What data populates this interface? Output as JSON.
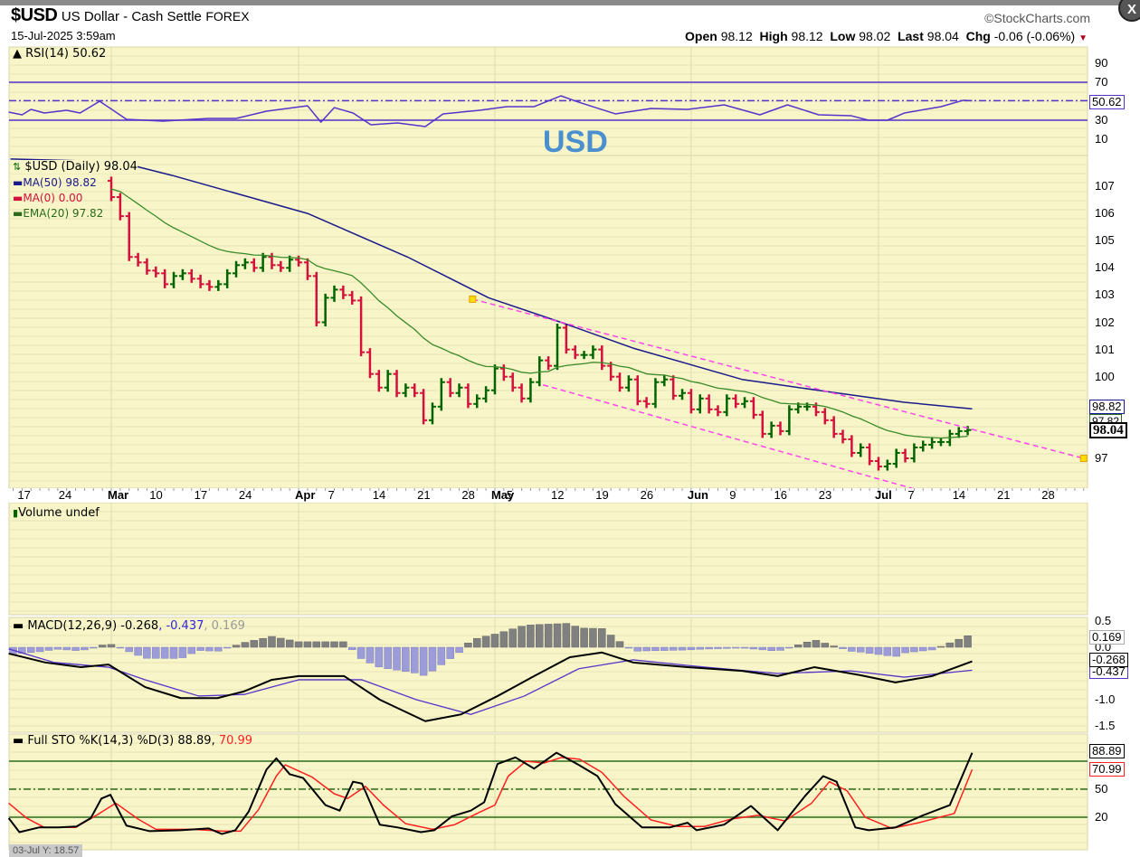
{
  "header": {
    "symbol": "$USD",
    "name": "US Dollar - Cash Settle",
    "exchange": "FOREX",
    "datetime": "15-Jul-2025 3:59am",
    "brand": "©StockCharts.com",
    "open_label": "Open",
    "open": "98.12",
    "high_label": "High",
    "high": "98.12",
    "low_label": "Low",
    "low": "98.02",
    "last_label": "Last",
    "last": "98.04",
    "chg_label": "Chg",
    "chg": "-0.06 (-0.06%)",
    "close_button": "X"
  },
  "watermark": "USD",
  "crosshair_readout": "03-Jul Y: 18.57",
  "colors": {
    "panel_bg": "#f8f6c8",
    "up": "#006400",
    "down": "#d4103c",
    "ma50": "#1a1a8c",
    "ema20": "#3a8a2a",
    "trend": "#ff44ee",
    "rsi": "#5533cc",
    "signal": "#5533cc",
    "stoD": "#ff2020"
  },
  "rsi": {
    "legend": "RSI(14) 50.62",
    "ticks": [
      "90",
      "70",
      "30",
      "10"
    ],
    "tag": "50.62",
    "series": [
      [
        -11.5,
        38.6
      ],
      [
        -10,
        35.7
      ],
      [
        -9,
        41.4
      ],
      [
        -7.5,
        37.6
      ],
      [
        -5,
        40.5
      ],
      [
        -3.5,
        37.6
      ],
      [
        -1.3,
        50
      ],
      [
        1.7,
        31
      ],
      [
        5.8,
        29
      ],
      [
        10.9,
        31.9
      ],
      [
        14,
        31.9
      ],
      [
        17.4,
        39.5
      ],
      [
        22,
        45.2
      ],
      [
        23.5,
        28
      ],
      [
        25,
        43.3
      ],
      [
        27.1,
        37.6
      ],
      [
        29.1,
        25.2
      ],
      [
        32.1,
        27.1
      ],
      [
        35.2,
        23.3
      ],
      [
        37.2,
        36.7
      ],
      [
        41.3,
        40.5
      ],
      [
        44.3,
        44.3
      ],
      [
        47.4,
        44.3
      ],
      [
        50.4,
        55.7
      ],
      [
        52.4,
        49
      ],
      [
        56.5,
        36.7
      ],
      [
        60.5,
        42.4
      ],
      [
        64.6,
        41.4
      ],
      [
        68.7,
        46.2
      ],
      [
        72.7,
        35.7
      ],
      [
        75.8,
        46.2
      ],
      [
        79.3,
        35.7
      ],
      [
        82.9,
        34.8
      ],
      [
        84.9,
        30
      ],
      [
        87,
        30
      ],
      [
        88.9,
        37.6
      ],
      [
        93,
        44.3
      ],
      [
        95.5,
        51
      ],
      [
        96.5,
        50.62
      ]
    ]
  },
  "price": {
    "legend_title": "$USD (Daily) 98.04",
    "ma50_legend": "MA(50) 98.82",
    "ma0_legend": "MA(0) 0.00",
    "ema20_legend": "EMA(20) 97.82",
    "ticks": [
      "107",
      "106",
      "105",
      "104",
      "103",
      "102",
      "101",
      "100",
      "97"
    ],
    "tag_ma50": "98.82",
    "tag_last": "98.04",
    "tag_ema": "97.82",
    "first_open": 107.2,
    "closes": [
      106.6,
      105.9,
      104.4,
      104.2,
      103.9,
      103.8,
      103.4,
      103.7,
      103.8,
      103.6,
      103.4,
      103.3,
      103.4,
      103.8,
      104.1,
      104.2,
      104.0,
      104.4,
      104.1,
      104.0,
      104.3,
      104.2,
      103.7,
      102.0,
      102.9,
      103.2,
      103.0,
      102.8,
      100.9,
      100.1,
      99.6,
      100.1,
      99.4,
      99.6,
      99.4,
      98.4,
      98.9,
      99.8,
      99.4,
      99.6,
      99.0,
      99.2,
      99.5,
      100.3,
      100.0,
      99.6,
      99.2,
      99.8,
      100.6,
      100.4,
      101.8,
      101.0,
      100.8,
      100.8,
      101.0,
      100.4,
      100.0,
      99.6,
      99.9,
      99.1,
      99.0,
      99.8,
      99.9,
      99.3,
      99.4,
      98.8,
      99.2,
      98.8,
      98.7,
      99.2,
      99.0,
      99.1,
      98.6,
      97.9,
      98.2,
      98.0,
      98.8,
      98.9,
      98.9,
      98.7,
      98.4,
      97.9,
      97.7,
      97.2,
      97.4,
      96.9,
      96.7,
      96.8,
      97.2,
      97.0,
      97.4,
      97.5,
      97.6,
      97.6,
      97.9,
      98.0,
      98.04
    ],
    "ma50": [
      [
        -11.3,
        108.0
      ],
      [
        0.7,
        107.9
      ],
      [
        6.8,
        107.4
      ],
      [
        22,
        106.0
      ],
      [
        33.2,
        104.4
      ],
      [
        42.3,
        102.9
      ],
      [
        50.4,
        102.0
      ],
      [
        58.5,
        101.05
      ],
      [
        70.7,
        99.9
      ],
      [
        80.3,
        99.45
      ],
      [
        88.9,
        99.06
      ],
      [
        96.5,
        98.82
      ]
    ],
    "trendlines": [
      {
        "from": [
          40.5,
          102.85
        ],
        "to": [
          109,
          97.0
        ],
        "anchors": true
      },
      {
        "from": [
          48.4,
          99.7
        ],
        "to": [
          93,
          95.6
        ],
        "anchors": false
      }
    ]
  },
  "x_axis": [
    {
      "d": -9.8,
      "label": "17",
      "month": false
    },
    {
      "d": -5.2,
      "label": "24",
      "month": false
    },
    {
      "d": 0,
      "label": "Mar",
      "month": true
    },
    {
      "d": 5,
      "label": "10",
      "month": false
    },
    {
      "d": 10,
      "label": "17",
      "month": false
    },
    {
      "d": 15,
      "label": "24",
      "month": false
    },
    {
      "d": 21,
      "label": "Apr",
      "month": true
    },
    {
      "d": 25,
      "label": "7",
      "month": false
    },
    {
      "d": 30,
      "label": "14",
      "month": false
    },
    {
      "d": 35,
      "label": "21",
      "month": false
    },
    {
      "d": 40,
      "label": "28",
      "month": false
    },
    {
      "d": 43,
      "label": "May",
      "month": true
    },
    {
      "d": 45,
      "label": "5",
      "month": false
    },
    {
      "d": 50,
      "label": "12",
      "month": false
    },
    {
      "d": 55,
      "label": "19",
      "month": false
    },
    {
      "d": 60,
      "label": "26",
      "month": false
    },
    {
      "d": 65,
      "label": "Jun",
      "month": true
    },
    {
      "d": 70,
      "label": "9",
      "month": false
    },
    {
      "d": 75,
      "label": "16",
      "month": false
    },
    {
      "d": 80,
      "label": "23",
      "month": false
    },
    {
      "d": 86,
      "label": "Jul",
      "month": true
    },
    {
      "d": 90,
      "label": "7",
      "month": false
    },
    {
      "d": 95,
      "label": "14",
      "month": false
    },
    {
      "d": 100,
      "label": "21",
      "month": false
    },
    {
      "d": 105,
      "label": "28",
      "month": false
    }
  ],
  "volume": {
    "legend": "Volume undef"
  },
  "macd": {
    "legend_main": "MACD(12,26,9) -0.268",
    "legend_signal": ", -0.437",
    "legend_hist": ", 0.169",
    "ticks": [
      "0.5",
      "0.0",
      "-1.0",
      "-1.5"
    ],
    "tag_hist": "0.169",
    "tag_macd": "-0.268",
    "tag_signal": "-0.437",
    "macd_line": [
      [
        -11.5,
        -0.12
      ],
      [
        -7.4,
        -0.29
      ],
      [
        -3.4,
        -0.38
      ],
      [
        -0.3,
        -0.33
      ],
      [
        3.8,
        -0.76
      ],
      [
        7.8,
        -0.97
      ],
      [
        11.9,
        -0.97
      ],
      [
        14.9,
        -0.84
      ],
      [
        18,
        -0.62
      ],
      [
        21,
        -0.55
      ],
      [
        26.1,
        -0.55
      ],
      [
        30.1,
        -1.0
      ],
      [
        35.2,
        -1.41
      ],
      [
        39.2,
        -1.28
      ],
      [
        43.3,
        -0.93
      ],
      [
        47.4,
        -0.55
      ],
      [
        51.4,
        -0.19
      ],
      [
        55,
        -0.1
      ],
      [
        58.5,
        -0.29
      ],
      [
        64.6,
        -0.38
      ],
      [
        70.7,
        -0.45
      ],
      [
        74.7,
        -0.55
      ],
      [
        78.8,
        -0.38
      ],
      [
        83.9,
        -0.53
      ],
      [
        87.9,
        -0.67
      ],
      [
        92,
        -0.55
      ],
      [
        96.5,
        -0.268
      ]
    ],
    "signal_line": [
      [
        -11.5,
        -0.03
      ],
      [
        -6.4,
        -0.29
      ],
      [
        -0.3,
        -0.38
      ],
      [
        3.8,
        -0.62
      ],
      [
        9.8,
        -0.93
      ],
      [
        14.9,
        -0.9
      ],
      [
        21,
        -0.62
      ],
      [
        28.1,
        -0.62
      ],
      [
        34.2,
        -1.0
      ],
      [
        40.3,
        -1.28
      ],
      [
        46.3,
        -0.93
      ],
      [
        52.4,
        -0.41
      ],
      [
        58.5,
        -0.24
      ],
      [
        66.6,
        -0.38
      ],
      [
        74.7,
        -0.5
      ],
      [
        82.9,
        -0.45
      ],
      [
        88.9,
        -0.57
      ],
      [
        96.5,
        -0.437
      ]
    ]
  },
  "sto": {
    "legend_main": "Full STO %K(14,3) %D(3) 88.89,",
    "legend_d": "70.99",
    "ticks": [
      "50",
      "20"
    ],
    "tag_k": "88.89",
    "tag_d": "70.99",
    "k_line": [
      [
        -11.5,
        19
      ],
      [
        -10.3,
        4
      ],
      [
        -8.1,
        9
      ],
      [
        -5.9,
        9
      ],
      [
        -3.9,
        10
      ],
      [
        -2.3,
        19
      ],
      [
        -1.1,
        40
      ],
      [
        -0.1,
        44
      ],
      [
        1.7,
        11
      ],
      [
        4.3,
        5
      ],
      [
        7.8,
        6
      ],
      [
        10.9,
        8
      ],
      [
        12.4,
        2
      ],
      [
        13.9,
        6
      ],
      [
        15.4,
        26
      ],
      [
        17.4,
        71
      ],
      [
        18.5,
        83
      ],
      [
        20,
        66
      ],
      [
        21.5,
        62
      ],
      [
        24,
        33
      ],
      [
        25.6,
        27
      ],
      [
        27.1,
        58
      ],
      [
        28.1,
        56
      ],
      [
        30.1,
        12
      ],
      [
        32.1,
        9
      ],
      [
        34.7,
        4
      ],
      [
        36.2,
        6
      ],
      [
        38.2,
        21
      ],
      [
        40.3,
        27
      ],
      [
        41.8,
        36
      ],
      [
        43.3,
        77
      ],
      [
        45.3,
        84
      ],
      [
        47.4,
        72
      ],
      [
        49.9,
        89
      ],
      [
        52.4,
        76
      ],
      [
        54.5,
        64
      ],
      [
        56.5,
        34
      ],
      [
        59.5,
        9
      ],
      [
        62.6,
        9
      ],
      [
        64.6,
        14
      ],
      [
        65.6,
        6
      ],
      [
        68.7,
        12
      ],
      [
        71.7,
        32
      ],
      [
        74.7,
        6
      ],
      [
        77.8,
        43
      ],
      [
        79.8,
        64
      ],
      [
        81.3,
        58
      ],
      [
        83.4,
        9
      ],
      [
        84.9,
        6
      ],
      [
        87.9,
        9
      ],
      [
        91,
        22
      ],
      [
        94,
        33
      ],
      [
        96.5,
        88.89
      ]
    ],
    "d_line": [
      [
        -11.5,
        35
      ],
      [
        -9.5,
        19
      ],
      [
        -7.5,
        9
      ],
      [
        -4,
        9
      ],
      [
        -1.5,
        23
      ],
      [
        0.5,
        35
      ],
      [
        3,
        18
      ],
      [
        5,
        7
      ],
      [
        9,
        7
      ],
      [
        12.5,
        5
      ],
      [
        14.5,
        5
      ],
      [
        16.5,
        28
      ],
      [
        18.5,
        64
      ],
      [
        19.5,
        76
      ],
      [
        22.5,
        63
      ],
      [
        25,
        45
      ],
      [
        26.5,
        40
      ],
      [
        28.5,
        53
      ],
      [
        30.5,
        33
      ],
      [
        33,
        13
      ],
      [
        36,
        7
      ],
      [
        38.5,
        12
      ],
      [
        41,
        24
      ],
      [
        43,
        33
      ],
      [
        44.5,
        64
      ],
      [
        46.5,
        80
      ],
      [
        48.5,
        78
      ],
      [
        50.5,
        84
      ],
      [
        52.5,
        82
      ],
      [
        55,
        68
      ],
      [
        57.5,
        42
      ],
      [
        60.5,
        17
      ],
      [
        63.5,
        10
      ],
      [
        66.5,
        10
      ],
      [
        69.5,
        18
      ],
      [
        72.5,
        22
      ],
      [
        75.5,
        16
      ],
      [
        78.5,
        35
      ],
      [
        80.5,
        58
      ],
      [
        82.5,
        48
      ],
      [
        84.5,
        20
      ],
      [
        87.5,
        8
      ],
      [
        90.5,
        14
      ],
      [
        94.5,
        24
      ],
      [
        96.5,
        70.99
      ]
    ]
  }
}
